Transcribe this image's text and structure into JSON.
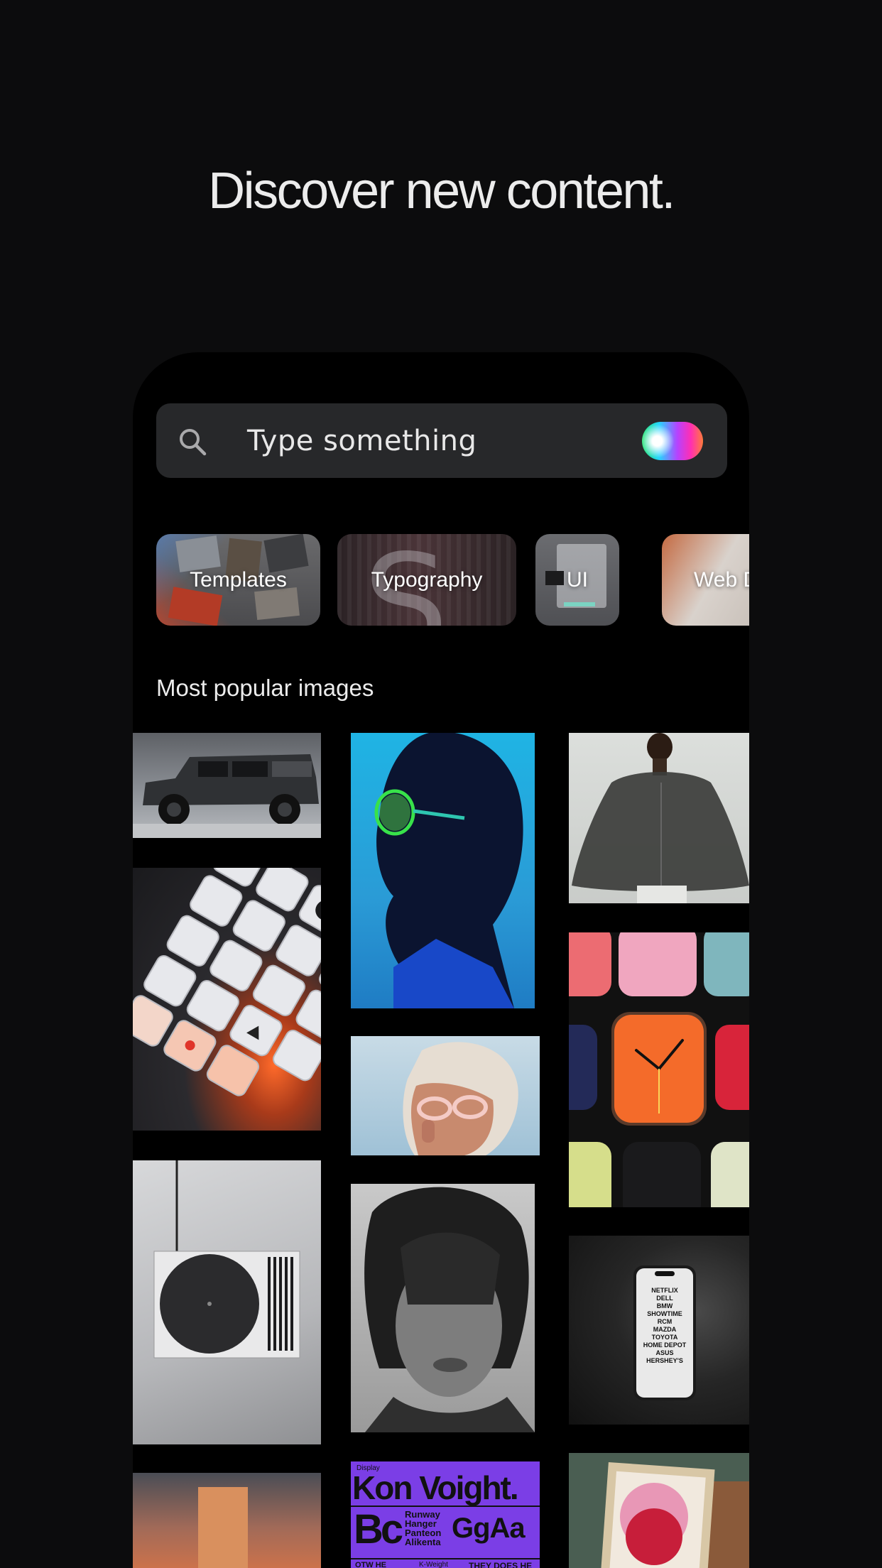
{
  "headline": "Discover new content.",
  "search": {
    "placeholder": "Type something",
    "icon": "search-icon",
    "voice_orb": "gradient-orb"
  },
  "categories": [
    {
      "label": "Templates"
    },
    {
      "label": "Typography"
    },
    {
      "label": "UI"
    },
    {
      "label": "Web Des"
    }
  ],
  "section_title": "Most popular images",
  "images": {
    "phone_screen_lines": [
      "NETFLIX",
      "DELL",
      "BMW",
      "SHOWTIME",
      "RCM",
      "MAZDA",
      "TOYOTA",
      "HOME DEPOT",
      "ASUS",
      "HERSHEY'S"
    ],
    "poster": {
      "tag": "Display",
      "title": "Kon Voight.",
      "big_letters": "Bc",
      "words": [
        "Runway",
        "Hanger",
        "Panteon",
        "Alikenta"
      ],
      "specimen": "GgAa",
      "footer_left": "OTW HE",
      "footer_mid": "K-Weight",
      "footer_right": "THEY DOES HE"
    }
  }
}
